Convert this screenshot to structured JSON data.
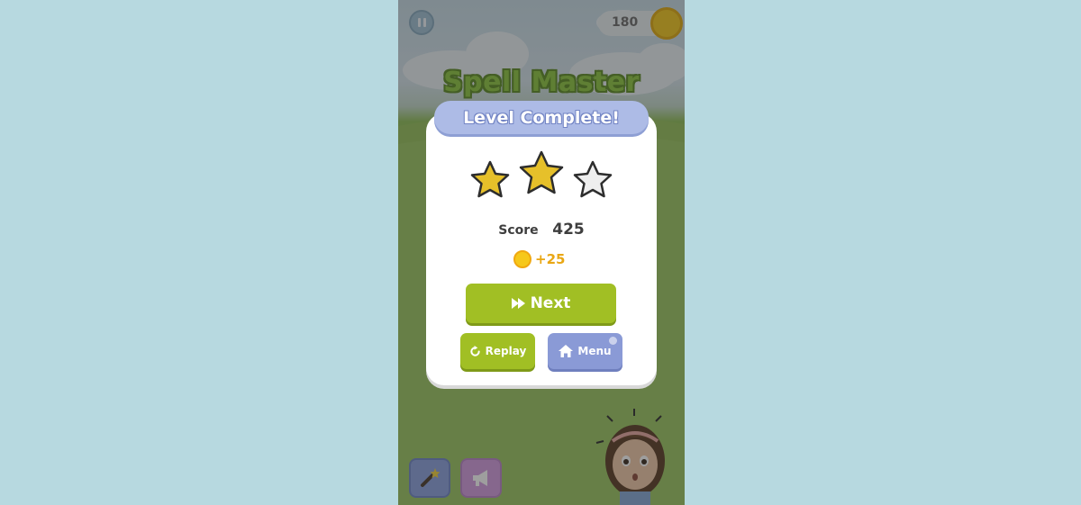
{
  "app": {
    "title": "Spell Master",
    "coins": "180"
  },
  "dialog": {
    "banner": "Level Complete!",
    "stars_earned": 2,
    "stars_total": 3,
    "score_label": "Score",
    "score_value": "425",
    "coin_reward": "+25",
    "buttons": {
      "next": "Next",
      "replay": "Replay",
      "menu": "Menu"
    }
  },
  "colors": {
    "accent_green": "#a1bf24",
    "accent_blue": "#8a9ad6",
    "star_gold": "#e6c02a",
    "star_empty": "#eeeeee",
    "coin": "#f6c81a"
  },
  "icons": {
    "next": "fast-forward-icon",
    "replay": "replay-icon",
    "menu": "home-icon",
    "power_up_1": "magic-wand-icon",
    "power_up_2": "megaphone-icon"
  }
}
